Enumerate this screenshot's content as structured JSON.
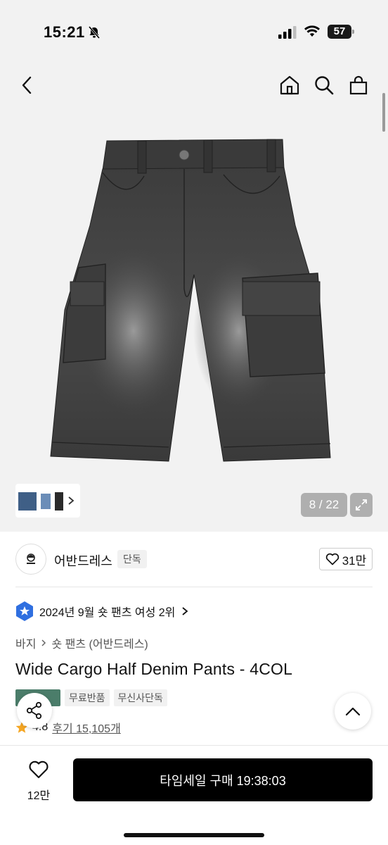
{
  "status_bar": {
    "time": "15:21",
    "battery": "57"
  },
  "header": {
    "icons": [
      "back-icon",
      "home-icon",
      "search-icon",
      "bag-icon"
    ]
  },
  "gallery": {
    "counter": "8 / 22",
    "image_alt": "Wide cargo half denim shorts, washed black"
  },
  "brand": {
    "name": "어반드레스",
    "exclusive_tag": "단독",
    "likes": "31만"
  },
  "ranking": {
    "text": "2024년 9월 숏 팬츠 여성 2위"
  },
  "breadcrumb": {
    "items": [
      "바지",
      "숏 팬츠 (어반드레스)"
    ]
  },
  "product": {
    "title": "Wide Cargo Half Denim Pants - 4COL"
  },
  "tags": [
    "무료반품",
    "무신사단독"
  ],
  "rating": {
    "score": "4.8",
    "reviews": "후기 15,105개"
  },
  "bottom_bar": {
    "wish_count": "12만",
    "buy_label": "타임세일 구매 19:38:03"
  },
  "colors": {
    "buy_button": "#000000",
    "tag_green": "#4b7d6a",
    "star": "#f5a623"
  }
}
